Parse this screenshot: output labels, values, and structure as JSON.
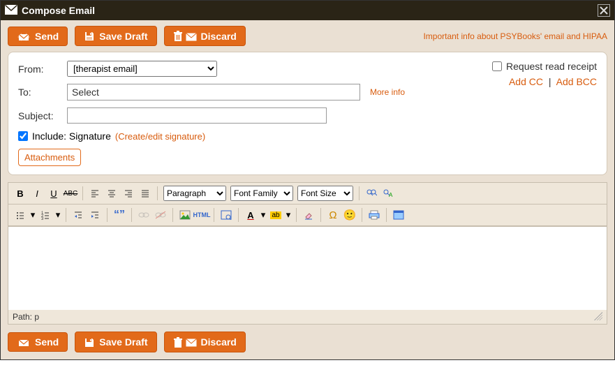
{
  "window": {
    "title": "Compose Email"
  },
  "buttons": {
    "send": "Send",
    "save_draft": "Save Draft",
    "discard": "Discard"
  },
  "links": {
    "hipaa": "Important info about PSYBooks' email and HIPAA",
    "more_info": "More info",
    "add_cc": "Add CC",
    "add_bcc": "Add BCC",
    "edit_sig": "(Create/edit signature)"
  },
  "form": {
    "from_label": "From:",
    "to_label": "To:",
    "subject_label": "Subject:",
    "from_value": "[therapist email]",
    "to_value": "Select",
    "subject_value": "",
    "request_read_receipt": "Request read receipt",
    "include_sig": "Include: Signature",
    "attachments": "Attachments"
  },
  "editor": {
    "format_select": "Paragraph",
    "font_family": "Font Family",
    "font_size": "Font Size",
    "path_label": "Path:",
    "path_value": "p"
  }
}
